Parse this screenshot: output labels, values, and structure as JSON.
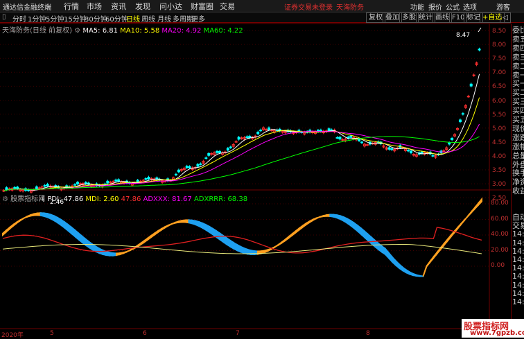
{
  "menubar": {
    "app_title": "通达信金融终端",
    "items": [
      "行情",
      "市场",
      "资讯",
      "发现",
      "问小达",
      "财富圈",
      "交易"
    ],
    "alert": "证券交易未登录",
    "stock_link": "天海防务",
    "right_items": [
      "功能",
      "报价",
      "公式",
      "选项"
    ],
    "guest": "游客"
  },
  "toolbar": {
    "periods": [
      "分时",
      "1分钟",
      "5分钟",
      "15分钟",
      "30分钟",
      "60分钟",
      "日线",
      "周线",
      "月线",
      "多周期",
      "更多"
    ],
    "active_period": "日线",
    "right_buttons": [
      "复权",
      "叠加",
      "多股",
      "统计",
      "画线",
      "F10",
      "标记",
      "+自选",
      "◁"
    ]
  },
  "main_info": {
    "title": "天海防务(日线 前复权)",
    "ma5": "MA5: 6.81",
    "ma10": "MA10: 5.58",
    "ma20": "MA20: 4.92",
    "ma60": "MA60: 4.22"
  },
  "main_yaxis": [
    "8.50",
    "8.00",
    "7.50",
    "7.00",
    "6.50",
    "6.00",
    "5.50",
    "5.00",
    "4.50",
    "4.00",
    "3.50",
    "3.00",
    "2.50"
  ],
  "annotations": {
    "high": "8.47",
    "low": "2.46"
  },
  "indicator_info": {
    "name": "股票指标网",
    "pdi": "PDI: 47.86",
    "mdi": "MDI: 2.60",
    "val3": "47.86",
    "adxxx": "ADXXX: 81.67",
    "adxrrr": "ADXRRR: 68.38"
  },
  "ind_yaxis": [
    "80.00",
    "60.00",
    "40.00",
    "20.00",
    "0.00"
  ],
  "xaxis": [
    "2020年",
    "5",
    "6",
    "7",
    "8"
  ],
  "right_panel": {
    "top": [
      "委比",
      "卖五",
      "卖四",
      "卖三",
      "卖二",
      "卖一",
      "买一",
      "买二",
      "买三",
      "买四",
      "买五",
      "现价",
      "涨跌",
      "涨幅",
      "总量",
      "外盘",
      "换手",
      "净资",
      "收益"
    ],
    "bottom": [
      "自动",
      "交易",
      "14:5",
      "14:5",
      "14:5",
      "14:5",
      "14:5",
      "14:5",
      "14:5",
      "14:5",
      "14:5"
    ]
  },
  "watermark": {
    "line1": "股票指标网",
    "line2": "www.7gpzb.com"
  },
  "colors": {
    "up": "#ff3030",
    "down": "#00ffff",
    "ma5": "#ffffff",
    "ma10": "#ffff00",
    "ma20": "#ff00ff",
    "ma60": "#00ff00",
    "band_up": "#ffa020",
    "band_down": "#1ea0f0",
    "pdi": "#e02020",
    "adxrrr": "#e8e87a",
    "grid": "#700000"
  }
}
